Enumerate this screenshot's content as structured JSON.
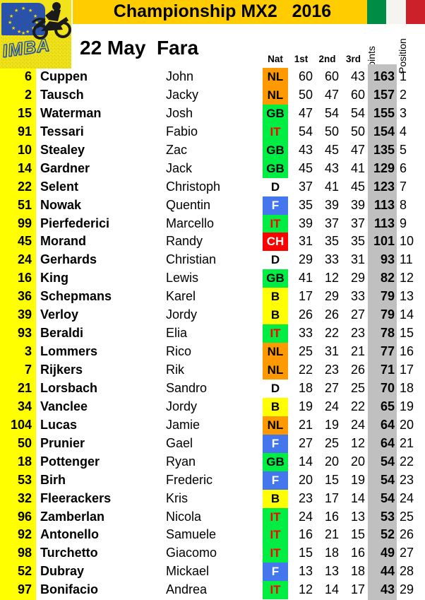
{
  "header": {
    "title": "Championship MX2   2016",
    "event": "22 May  Fara",
    "logo_text": "IMBA",
    "flag_right": "italy-flag",
    "flag_colors": [
      "#008c45",
      "#f4f5f0",
      "#cd212a"
    ]
  },
  "columns": {
    "nat": "Nat",
    "race1": "1st",
    "race2": "2nd",
    "race3": "3rd",
    "points": "Points",
    "position": "Position"
  },
  "nat_styles": {
    "NL": {
      "bg": "#ff9900",
      "fg": "#000000"
    },
    "GB": {
      "bg": "#00ee44",
      "fg": "#000000"
    },
    "IT": {
      "bg": "#00ee44",
      "fg": "#ff0000"
    },
    "D": {
      "bg": "#ffffff",
      "fg": "#000000"
    },
    "F": {
      "bg": "#4477ee",
      "fg": "#ffffff"
    },
    "CH": {
      "bg": "#ff0000",
      "fg": "#ffffff"
    },
    "B": {
      "bg": "#ffff00",
      "fg": "#000000"
    }
  },
  "colors": {
    "title_band": "#ffcc00",
    "number_column": "#ffff00",
    "points_column": "#c0c0c0",
    "logo_bg": "#f2e21a"
  },
  "rows": [
    {
      "num": "6",
      "last": "Cuppen",
      "first": "John",
      "nat": "NL",
      "r1": "60",
      "r2": "60",
      "r3": "43",
      "pts": "163",
      "pos": "1"
    },
    {
      "num": "2",
      "last": "Tausch",
      "first": "Jacky",
      "nat": "NL",
      "r1": "50",
      "r2": "47",
      "r3": "60",
      "pts": "157",
      "pos": "2"
    },
    {
      "num": "15",
      "last": "Waterman",
      "first": "Josh",
      "nat": "GB",
      "r1": "47",
      "r2": "54",
      "r3": "54",
      "pts": "155",
      "pos": "3"
    },
    {
      "num": "91",
      "last": "Tessari",
      "first": "Fabio",
      "nat": "IT",
      "r1": "54",
      "r2": "50",
      "r3": "50",
      "pts": "154",
      "pos": "4"
    },
    {
      "num": "10",
      "last": "Stealey",
      "first": "Zac",
      "nat": "GB",
      "r1": "43",
      "r2": "45",
      "r3": "47",
      "pts": "135",
      "pos": "5"
    },
    {
      "num": "14",
      "last": "Gardner",
      "first": "Jack",
      "nat": "GB",
      "r1": "45",
      "r2": "43",
      "r3": "41",
      "pts": "129",
      "pos": "6"
    },
    {
      "num": "22",
      "last": "Selent",
      "first": "Christoph",
      "nat": "D",
      "r1": "37",
      "r2": "41",
      "r3": "45",
      "pts": "123",
      "pos": "7"
    },
    {
      "num": "51",
      "last": "Nowak",
      "first": "Quentin",
      "nat": "F",
      "r1": "35",
      "r2": "39",
      "r3": "39",
      "pts": "113",
      "pos": "8"
    },
    {
      "num": "99",
      "last": "Pierfederici",
      "first": "Marcello",
      "nat": "IT",
      "r1": "39",
      "r2": "37",
      "r3": "37",
      "pts": "113",
      "pos": "9"
    },
    {
      "num": "45",
      "last": "Morand",
      "first": "Randy",
      "nat": "CH",
      "r1": "31",
      "r2": "35",
      "r3": "35",
      "pts": "101",
      "pos": "10"
    },
    {
      "num": "24",
      "last": "Gerhards",
      "first": "Christian",
      "nat": "D",
      "r1": "29",
      "r2": "33",
      "r3": "31",
      "pts": "93",
      "pos": "11"
    },
    {
      "num": "16",
      "last": "King",
      "first": "Lewis",
      "nat": "GB",
      "r1": "41",
      "r2": "12",
      "r3": "29",
      "pts": "82",
      "pos": "12"
    },
    {
      "num": "36",
      "last": "Schepmans",
      "first": "Karel",
      "nat": "B",
      "r1": "17",
      "r2": "29",
      "r3": "33",
      "pts": "79",
      "pos": "13"
    },
    {
      "num": "39",
      "last": "Verloy",
      "first": "Jordy",
      "nat": "B",
      "r1": "26",
      "r2": "26",
      "r3": "27",
      "pts": "79",
      "pos": "14"
    },
    {
      "num": "93",
      "last": "Beraldi",
      "first": "Elia",
      "nat": "IT",
      "r1": "33",
      "r2": "22",
      "r3": "23",
      "pts": "78",
      "pos": "15"
    },
    {
      "num": "3",
      "last": "Lommers",
      "first": "Rico",
      "nat": "NL",
      "r1": "25",
      "r2": "31",
      "r3": "21",
      "pts": "77",
      "pos": "16"
    },
    {
      "num": "7",
      "last": "Rijkers",
      "first": "Rik",
      "nat": "NL",
      "r1": "22",
      "r2": "23",
      "r3": "26",
      "pts": "71",
      "pos": "17"
    },
    {
      "num": "21",
      "last": "Lorsbach",
      "first": "Sandro",
      "nat": "D",
      "r1": "18",
      "r2": "27",
      "r3": "25",
      "pts": "70",
      "pos": "18"
    },
    {
      "num": "34",
      "last": "Vanclee",
      "first": "Jordy",
      "nat": "B",
      "r1": "19",
      "r2": "24",
      "r3": "22",
      "pts": "65",
      "pos": "19"
    },
    {
      "num": "104",
      "last": "Lucas",
      "first": "Jamie",
      "nat": "NL",
      "r1": "21",
      "r2": "19",
      "r3": "24",
      "pts": "64",
      "pos": "20"
    },
    {
      "num": "50",
      "last": "Prunier",
      "first": "Gael",
      "nat": "F",
      "r1": "27",
      "r2": "25",
      "r3": "12",
      "pts": "64",
      "pos": "21"
    },
    {
      "num": "18",
      "last": "Pottenger",
      "first": "Ryan",
      "nat": "GB",
      "r1": "14",
      "r2": "20",
      "r3": "20",
      "pts": "54",
      "pos": "22"
    },
    {
      "num": "53",
      "last": "Birh",
      "first": "Frederic",
      "nat": "F",
      "r1": "20",
      "r2": "15",
      "r3": "19",
      "pts": "54",
      "pos": "23"
    },
    {
      "num": "32",
      "last": "Fleerackers",
      "first": "Kris",
      "nat": "B",
      "r1": "23",
      "r2": "17",
      "r3": "14",
      "pts": "54",
      "pos": "24"
    },
    {
      "num": "96",
      "last": "Zamberlan",
      "first": "Nicola",
      "nat": "IT",
      "r1": "24",
      "r2": "16",
      "r3": "13",
      "pts": "53",
      "pos": "25"
    },
    {
      "num": "92",
      "last": "Antonello",
      "first": "Samuele",
      "nat": "IT",
      "r1": "16",
      "r2": "21",
      "r3": "15",
      "pts": "52",
      "pos": "26"
    },
    {
      "num": "98",
      "last": "Turchetto",
      "first": "Giacomo",
      "nat": "IT",
      "r1": "15",
      "r2": "18",
      "r3": "16",
      "pts": "49",
      "pos": "27"
    },
    {
      "num": "52",
      "last": "Dubray",
      "first": "Mickael",
      "nat": "F",
      "r1": "13",
      "r2": "13",
      "r3": "18",
      "pts": "44",
      "pos": "28"
    },
    {
      "num": "97",
      "last": "Bonifacio",
      "first": "Andrea",
      "nat": "IT",
      "r1": "12",
      "r2": "14",
      "r3": "17",
      "pts": "43",
      "pos": "29"
    }
  ]
}
